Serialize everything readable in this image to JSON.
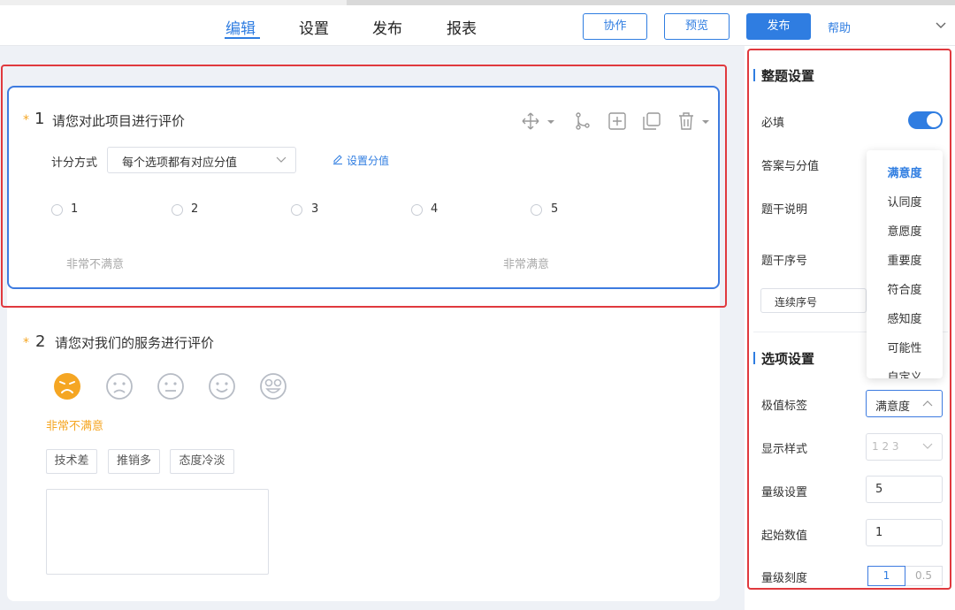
{
  "header": {
    "tabs": [
      {
        "label": "编辑",
        "active": true
      },
      {
        "label": "设置",
        "active": false
      },
      {
        "label": "发布",
        "active": false
      },
      {
        "label": "报表",
        "active": false
      }
    ],
    "collaborate_label": "协作",
    "preview_label": "预览",
    "publish_label": "发布",
    "help_label": "帮助"
  },
  "question1": {
    "required_mark": "*",
    "number": "1",
    "title": "请您对此项目进行评价",
    "scoring_label": "计分方式",
    "scoring_value": "每个选项都有对应分值",
    "set_score_label": "设置分值",
    "options": [
      "1",
      "2",
      "3",
      "4",
      "5"
    ],
    "low_label": "非常不满意",
    "high_label": "非常满意"
  },
  "question2": {
    "required_mark": "*",
    "number": "2",
    "title": "请您对我们的服务进行评价",
    "selected_label": "非常不满意",
    "tags": [
      "技术差",
      "推销多",
      "态度冷淡"
    ]
  },
  "panel": {
    "section1_title": "整题设置",
    "required_label": "必填",
    "answer_score_label": "答案与分值",
    "stem_desc_label": "题干说明",
    "stem_seq_label": "题干序号",
    "seq_value": "连续序号",
    "section2_title": "选项设置",
    "extreme_label": "极值标签",
    "extreme_value": "满意度",
    "display_label": "显示样式",
    "display_value": "1  2  3",
    "levels_label": "量级设置",
    "levels_value": "5",
    "start_label": "起始数值",
    "start_value": "1",
    "scale_label": "量级刻度",
    "scale_options": [
      "1",
      "0.5"
    ],
    "dropdown": [
      "满意度",
      "认同度",
      "意愿度",
      "重要度",
      "符合度",
      "感知度",
      "可能性",
      "自定义"
    ]
  },
  "colors": {
    "accent": "#2f7de1",
    "highlight": "#e0393e",
    "star": "#f5a623"
  }
}
